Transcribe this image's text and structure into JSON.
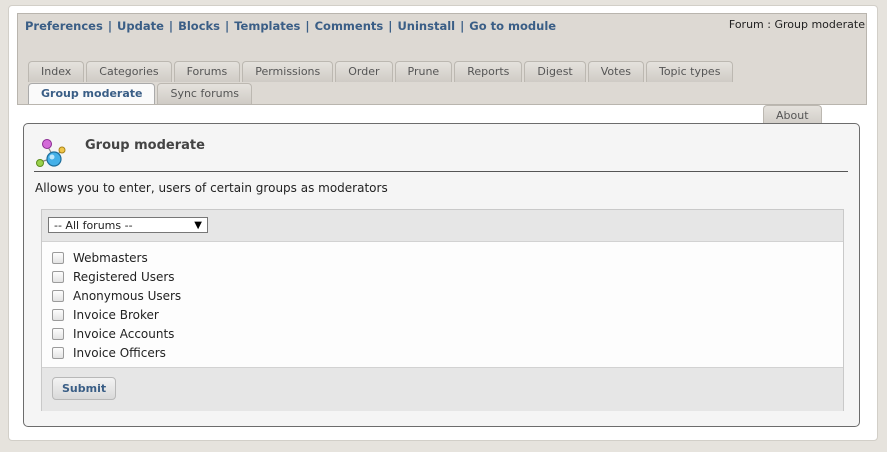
{
  "top_nav": {
    "links": [
      "Preferences",
      "Update",
      "Blocks",
      "Templates",
      "Comments",
      "Uninstall",
      "Go to module"
    ],
    "separator": "|"
  },
  "breadcrumb": {
    "text": "Forum : Group moderate"
  },
  "tabs": {
    "items": [
      "Index",
      "Categories",
      "Forums",
      "Permissions",
      "Order",
      "Prune",
      "Reports",
      "Digest",
      "Votes",
      "Topic types",
      "Group moderate",
      "Sync forums",
      "About"
    ],
    "active": "Group moderate"
  },
  "panel": {
    "title": "Group moderate",
    "icon": "module-network-icon",
    "description": "Allows you to enter, users of certain groups as moderators"
  },
  "filter": {
    "forum_select_value": "-- All forums --"
  },
  "groups": [
    {
      "label": "Webmasters",
      "checked": false
    },
    {
      "label": "Registered Users",
      "checked": false
    },
    {
      "label": "Anonymous Users",
      "checked": false
    },
    {
      "label": "Invoice Broker",
      "checked": false
    },
    {
      "label": "Invoice Accounts",
      "checked": false
    },
    {
      "label": "Invoice Officers",
      "checked": false
    }
  ],
  "actions": {
    "submit_label": "Submit"
  },
  "colors": {
    "link": "#3a5e86",
    "page_bg": "#e6e3dd",
    "header_bg": "#ddd9d3"
  }
}
